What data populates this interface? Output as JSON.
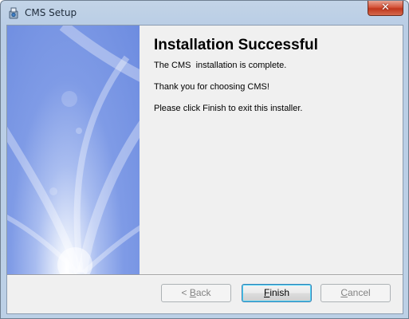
{
  "window": {
    "title": "CMS Setup",
    "close_glyph": "✕"
  },
  "content": {
    "heading": "Installation Successful",
    "lines": [
      "The CMS  installation is complete.",
      "Thank you for choosing CMS!",
      "Please click Finish to exit this installer."
    ]
  },
  "buttons": {
    "back": {
      "mnemonic": "< ",
      "underlined": "B",
      "rest": "ack",
      "enabled": false
    },
    "finish": {
      "underlined": "F",
      "rest": "inish",
      "enabled": true,
      "default": true
    },
    "cancel": {
      "underlined": "C",
      "rest": "ancel",
      "enabled": false
    }
  },
  "icons": {
    "app": "setup-installer-icon",
    "close": "close-icon"
  },
  "colors": {
    "banner_blue": "#7f9be6",
    "close_red": "#c0371d",
    "default_button_border": "#3c7fb1"
  }
}
